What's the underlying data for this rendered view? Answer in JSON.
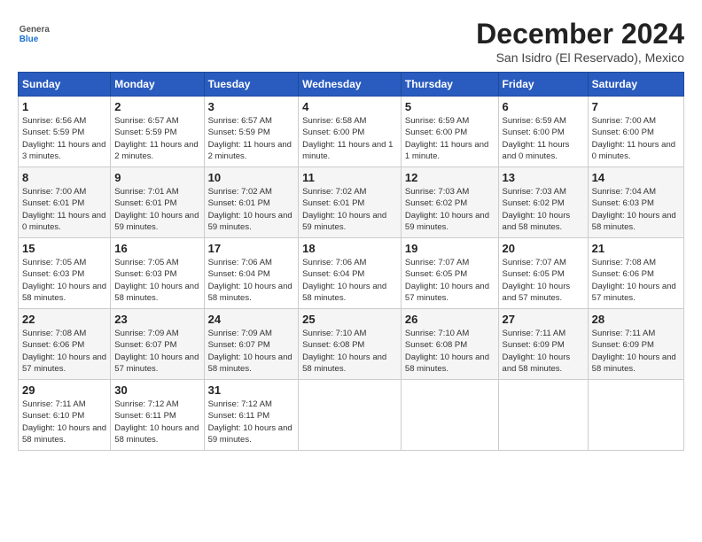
{
  "logo": {
    "general": "General",
    "blue": "Blue"
  },
  "title": "December 2024",
  "location": "San Isidro (El Reservado), Mexico",
  "days_of_week": [
    "Sunday",
    "Monday",
    "Tuesday",
    "Wednesday",
    "Thursday",
    "Friday",
    "Saturday"
  ],
  "weeks": [
    [
      {
        "day": "1",
        "sunrise": "6:56 AM",
        "sunset": "5:59 PM",
        "daylight": "11 hours and 3 minutes."
      },
      {
        "day": "2",
        "sunrise": "6:57 AM",
        "sunset": "5:59 PM",
        "daylight": "11 hours and 2 minutes."
      },
      {
        "day": "3",
        "sunrise": "6:57 AM",
        "sunset": "5:59 PM",
        "daylight": "11 hours and 2 minutes."
      },
      {
        "day": "4",
        "sunrise": "6:58 AM",
        "sunset": "6:00 PM",
        "daylight": "11 hours and 1 minute."
      },
      {
        "day": "5",
        "sunrise": "6:59 AM",
        "sunset": "6:00 PM",
        "daylight": "11 hours and 1 minute."
      },
      {
        "day": "6",
        "sunrise": "6:59 AM",
        "sunset": "6:00 PM",
        "daylight": "11 hours and 0 minutes."
      },
      {
        "day": "7",
        "sunrise": "7:00 AM",
        "sunset": "6:00 PM",
        "daylight": "11 hours and 0 minutes."
      }
    ],
    [
      {
        "day": "8",
        "sunrise": "7:00 AM",
        "sunset": "6:01 PM",
        "daylight": "11 hours and 0 minutes."
      },
      {
        "day": "9",
        "sunrise": "7:01 AM",
        "sunset": "6:01 PM",
        "daylight": "10 hours and 59 minutes."
      },
      {
        "day": "10",
        "sunrise": "7:02 AM",
        "sunset": "6:01 PM",
        "daylight": "10 hours and 59 minutes."
      },
      {
        "day": "11",
        "sunrise": "7:02 AM",
        "sunset": "6:01 PM",
        "daylight": "10 hours and 59 minutes."
      },
      {
        "day": "12",
        "sunrise": "7:03 AM",
        "sunset": "6:02 PM",
        "daylight": "10 hours and 59 minutes."
      },
      {
        "day": "13",
        "sunrise": "7:03 AM",
        "sunset": "6:02 PM",
        "daylight": "10 hours and 58 minutes."
      },
      {
        "day": "14",
        "sunrise": "7:04 AM",
        "sunset": "6:03 PM",
        "daylight": "10 hours and 58 minutes."
      }
    ],
    [
      {
        "day": "15",
        "sunrise": "7:05 AM",
        "sunset": "6:03 PM",
        "daylight": "10 hours and 58 minutes."
      },
      {
        "day": "16",
        "sunrise": "7:05 AM",
        "sunset": "6:03 PM",
        "daylight": "10 hours and 58 minutes."
      },
      {
        "day": "17",
        "sunrise": "7:06 AM",
        "sunset": "6:04 PM",
        "daylight": "10 hours and 58 minutes."
      },
      {
        "day": "18",
        "sunrise": "7:06 AM",
        "sunset": "6:04 PM",
        "daylight": "10 hours and 58 minutes."
      },
      {
        "day": "19",
        "sunrise": "7:07 AM",
        "sunset": "6:05 PM",
        "daylight": "10 hours and 57 minutes."
      },
      {
        "day": "20",
        "sunrise": "7:07 AM",
        "sunset": "6:05 PM",
        "daylight": "10 hours and 57 minutes."
      },
      {
        "day": "21",
        "sunrise": "7:08 AM",
        "sunset": "6:06 PM",
        "daylight": "10 hours and 57 minutes."
      }
    ],
    [
      {
        "day": "22",
        "sunrise": "7:08 AM",
        "sunset": "6:06 PM",
        "daylight": "10 hours and 57 minutes."
      },
      {
        "day": "23",
        "sunrise": "7:09 AM",
        "sunset": "6:07 PM",
        "daylight": "10 hours and 57 minutes."
      },
      {
        "day": "24",
        "sunrise": "7:09 AM",
        "sunset": "6:07 PM",
        "daylight": "10 hours and 58 minutes."
      },
      {
        "day": "25",
        "sunrise": "7:10 AM",
        "sunset": "6:08 PM",
        "daylight": "10 hours and 58 minutes."
      },
      {
        "day": "26",
        "sunrise": "7:10 AM",
        "sunset": "6:08 PM",
        "daylight": "10 hours and 58 minutes."
      },
      {
        "day": "27",
        "sunrise": "7:11 AM",
        "sunset": "6:09 PM",
        "daylight": "10 hours and 58 minutes."
      },
      {
        "day": "28",
        "sunrise": "7:11 AM",
        "sunset": "6:09 PM",
        "daylight": "10 hours and 58 minutes."
      }
    ],
    [
      {
        "day": "29",
        "sunrise": "7:11 AM",
        "sunset": "6:10 PM",
        "daylight": "10 hours and 58 minutes."
      },
      {
        "day": "30",
        "sunrise": "7:12 AM",
        "sunset": "6:11 PM",
        "daylight": "10 hours and 58 minutes."
      },
      {
        "day": "31",
        "sunrise": "7:12 AM",
        "sunset": "6:11 PM",
        "daylight": "10 hours and 59 minutes."
      },
      null,
      null,
      null,
      null
    ]
  ],
  "labels": {
    "sunrise": "Sunrise:",
    "sunset": "Sunset:",
    "daylight": "Daylight:"
  }
}
